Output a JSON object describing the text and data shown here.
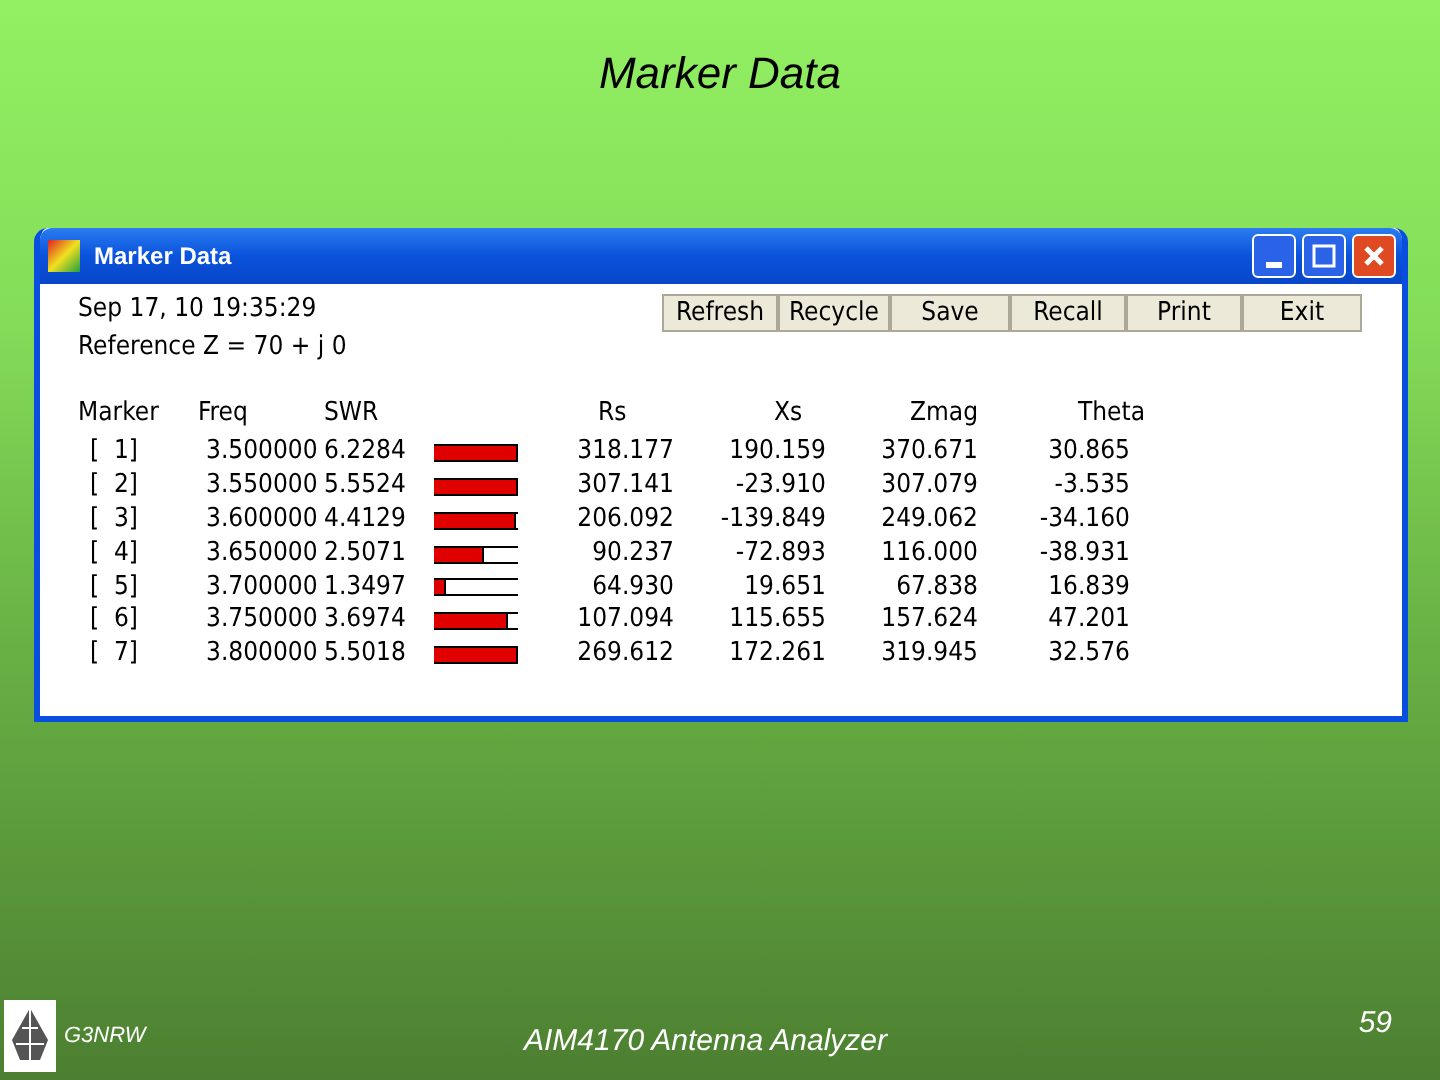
{
  "slide_title": "Marker Data",
  "window": {
    "title": "Marker Data",
    "timestamp": "Sep 17, 10  19:35:29",
    "reference": "Reference Z = 70  + j 0",
    "buttons": [
      "Refresh",
      "Recycle",
      "Save",
      "Recall",
      "Print",
      "Exit"
    ],
    "table": {
      "columns": [
        "Marker",
        "Freq",
        "SWR",
        "Rs",
        "Xs",
        "Zmag",
        "Theta"
      ],
      "rows": [
        {
          "marker": "[  1]",
          "freq": "3.500000",
          "swr": "6.2284",
          "level": 1.0,
          "rs": "318.177",
          "xs": "190.159",
          "zmag": "370.671",
          "theta": "30.865"
        },
        {
          "marker": "[  2]",
          "freq": "3.550000",
          "swr": "5.5524",
          "level": 1.0,
          "rs": "307.141",
          "xs": "-23.910",
          "zmag": "307.079",
          "theta": "-3.535"
        },
        {
          "marker": "[  3]",
          "freq": "3.600000",
          "swr": "4.4129",
          "level": 0.98,
          "rs": "206.092",
          "xs": "-139.849",
          "zmag": "249.062",
          "theta": "-34.160"
        },
        {
          "marker": "[  4]",
          "freq": "3.650000",
          "swr": "2.5071",
          "level": 0.6,
          "rs": "90.237",
          "xs": "-72.893",
          "zmag": "116.000",
          "theta": "-38.931"
        },
        {
          "marker": "[  5]",
          "freq": "3.700000",
          "swr": "1.3497",
          "level": 0.15,
          "rs": "64.930",
          "xs": "19.651",
          "zmag": "67.838",
          "theta": "16.839"
        },
        {
          "marker": "[  6]",
          "freq": "3.750000",
          "swr": "3.6974",
          "level": 0.87,
          "rs": "107.094",
          "xs": "115.655",
          "zmag": "157.624",
          "theta": "47.201"
        },
        {
          "marker": "[  7]",
          "freq": "3.800000",
          "swr": "5.5018",
          "level": 1.0,
          "rs": "269.612",
          "xs": "172.261",
          "zmag": "319.945",
          "theta": "32.576"
        }
      ]
    }
  },
  "footer": {
    "author": "G3NRW",
    "title": "AIM4170 Antenna Analyzer",
    "page": "59"
  }
}
